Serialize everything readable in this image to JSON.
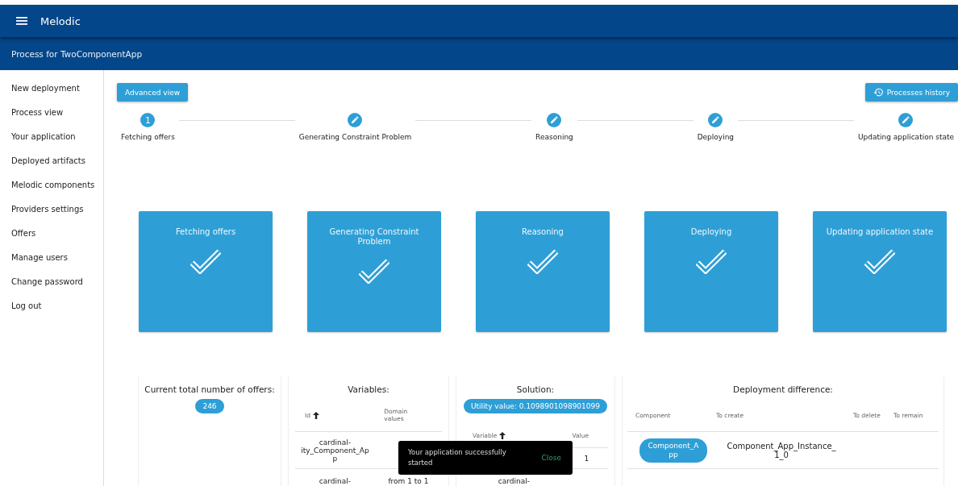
{
  "app_bar": {
    "title": "Melodic"
  },
  "sub_bar": {
    "title": "Process for TwoComponentApp"
  },
  "sidebar": {
    "items": [
      {
        "label": "New deployment"
      },
      {
        "label": "Process view"
      },
      {
        "label": "Your application"
      },
      {
        "label": "Deployed artifacts"
      },
      {
        "label": "Melodic components"
      },
      {
        "label": "Providers settings"
      },
      {
        "label": "Offers"
      },
      {
        "label": "Manage users"
      },
      {
        "label": "Change password"
      },
      {
        "label": "Log out"
      }
    ]
  },
  "toolbar": {
    "advanced_button": "Advanced view",
    "history_button": "Processes history"
  },
  "stepper": [
    {
      "kind": "number",
      "number": "1",
      "label": "Fetching offers"
    },
    {
      "kind": "edit",
      "label": "Generating Constraint Problem"
    },
    {
      "kind": "edit",
      "label": "Reasoning"
    },
    {
      "kind": "edit",
      "label": "Deploying"
    },
    {
      "kind": "edit",
      "label": "Updating application state"
    }
  ],
  "stage_cards": [
    {
      "title": "Fetching offers",
      "completed": true
    },
    {
      "title": "Generating Constraint Problem",
      "completed": true
    },
    {
      "title": "Reasoning",
      "completed": true
    },
    {
      "title": "Deploying",
      "completed": true
    },
    {
      "title": "Updating application state",
      "completed": true
    }
  ],
  "offers_panel": {
    "title": "Current total number of offers:",
    "count": "246"
  },
  "variables_panel": {
    "title": "Variables:",
    "columns": [
      {
        "label": "Id",
        "sorted": true
      },
      {
        "label": "Domain values",
        "sorted": false
      }
    ],
    "rows": [
      [
        "cardinal-ity_Component_App",
        ""
      ],
      [
        "cardinal-",
        "from 1 to 1"
      ]
    ]
  },
  "solution_panel": {
    "title": "Solution:",
    "utility": "Utility value: 0.1098901098901099",
    "columns": [
      {
        "label": "Variable",
        "sorted": true
      },
      {
        "label": "Value",
        "sorted": false
      }
    ],
    "rows": [
      [
        "",
        "1"
      ],
      [
        "cardinal-",
        ""
      ]
    ]
  },
  "deployment_panel": {
    "title": "Deployment difference:",
    "columns": [
      "Component",
      "To create",
      "To delete",
      "To remain"
    ],
    "rows": [
      {
        "component": "Component_App",
        "to_create": "Component_App_Instance_1_0"
      }
    ]
  },
  "snackbar": {
    "message": "Your application successfully started",
    "action": "Close"
  }
}
